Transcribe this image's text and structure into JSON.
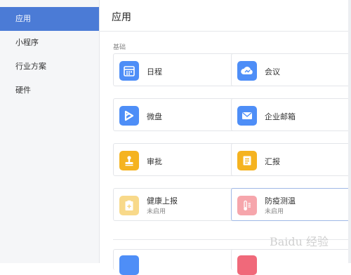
{
  "sidebar": {
    "items": [
      {
        "label": "应用"
      },
      {
        "label": "小程序"
      },
      {
        "label": "行业方案"
      },
      {
        "label": "硬件"
      }
    ],
    "active_index": 0
  },
  "main": {
    "title": "应用",
    "section_label": "基础",
    "cards": [
      {
        "name": "日程",
        "icon": "calendar-icon",
        "color": "#4e8ef7",
        "status": ""
      },
      {
        "name": "会议",
        "icon": "cloud-meeting-icon",
        "color": "#4e8ef7",
        "status": ""
      },
      {
        "name": "微盘",
        "icon": "drive-icon",
        "color": "#4e8ef7",
        "status": ""
      },
      {
        "name": "企业邮箱",
        "icon": "mail-icon",
        "color": "#4e8ef7",
        "status": ""
      },
      {
        "name": "审批",
        "icon": "stamp-icon",
        "color": "#f5b320",
        "status": ""
      },
      {
        "name": "汇报",
        "icon": "report-icon",
        "color": "#f5b320",
        "status": ""
      },
      {
        "name": "健康上报",
        "icon": "health-icon",
        "color": "#f8d98a",
        "status": "未启用"
      },
      {
        "name": "防疫测温",
        "icon": "thermometer-icon",
        "color": "#f6a6ac",
        "status": "未启用"
      }
    ],
    "next_row": [
      {
        "icon": "app-icon",
        "color": "#4e8ef7"
      },
      {
        "icon": "app-icon",
        "color": "#f0697a"
      }
    ]
  },
  "watermark": "Baidu 经验"
}
